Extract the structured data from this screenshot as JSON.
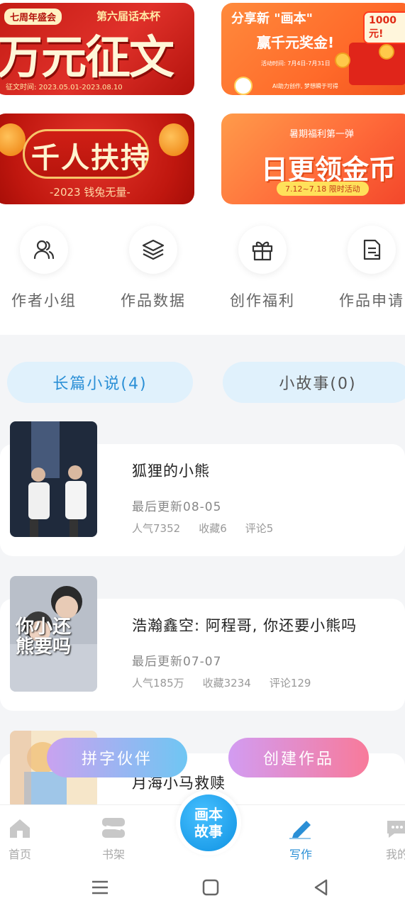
{
  "banners": {
    "b1": {
      "tag": "七周年盛会",
      "sub": "第六届话本杯",
      "title": "万元征文",
      "date": "征文时间: 2023.05.01-2023.08.10"
    },
    "b2": {
      "title": "分享新 \"画本\"",
      "sub": "赢千元奖金!",
      "badge": "1000元!",
      "date": "活动时间: 7月4日-7月31日",
      "foot": "AI助力创作, 梦想瞬于可得"
    },
    "b3": {
      "title": "千人扶持",
      "sub": "-2023 钱兔无量-"
    },
    "b4": {
      "top": "暑期福利第一弹",
      "title": "日更领金币",
      "pill": "7.12~7.18 限时活动"
    }
  },
  "quick": [
    {
      "label": "作者小组",
      "icon": "users-icon"
    },
    {
      "label": "作品数据",
      "icon": "layers-icon"
    },
    {
      "label": "创作福利",
      "icon": "gift-icon"
    },
    {
      "label": "作品申请",
      "icon": "document-icon"
    }
  ],
  "tabs": {
    "long": "长篇小说(4)",
    "short": "小故事(0)"
  },
  "works": [
    {
      "title": "狐狸的小熊",
      "updated": "最后更新08-05",
      "popularity": "人气7352",
      "favorites": "收藏6",
      "comments": "评论5"
    },
    {
      "title": "浩瀚鑫空: 阿程哥, 你还要小熊吗",
      "updated": "最后更新07-07",
      "popularity": "人气185万",
      "favorites": "收藏3234",
      "comments": "评论129",
      "cover_title": "你小还熊要吗"
    },
    {
      "title": "月海小马救赎"
    }
  ],
  "fabs": {
    "partner": "拼字伙伴",
    "create": "创建作品"
  },
  "nav": {
    "home": "首页",
    "shelf": "书架",
    "center": "画本故事",
    "write": "写作",
    "mine": "我的"
  },
  "colors": {
    "accent": "#2a8fd6",
    "nav_center": "#1a9be8",
    "tab_bg": "#e0f1fc"
  }
}
